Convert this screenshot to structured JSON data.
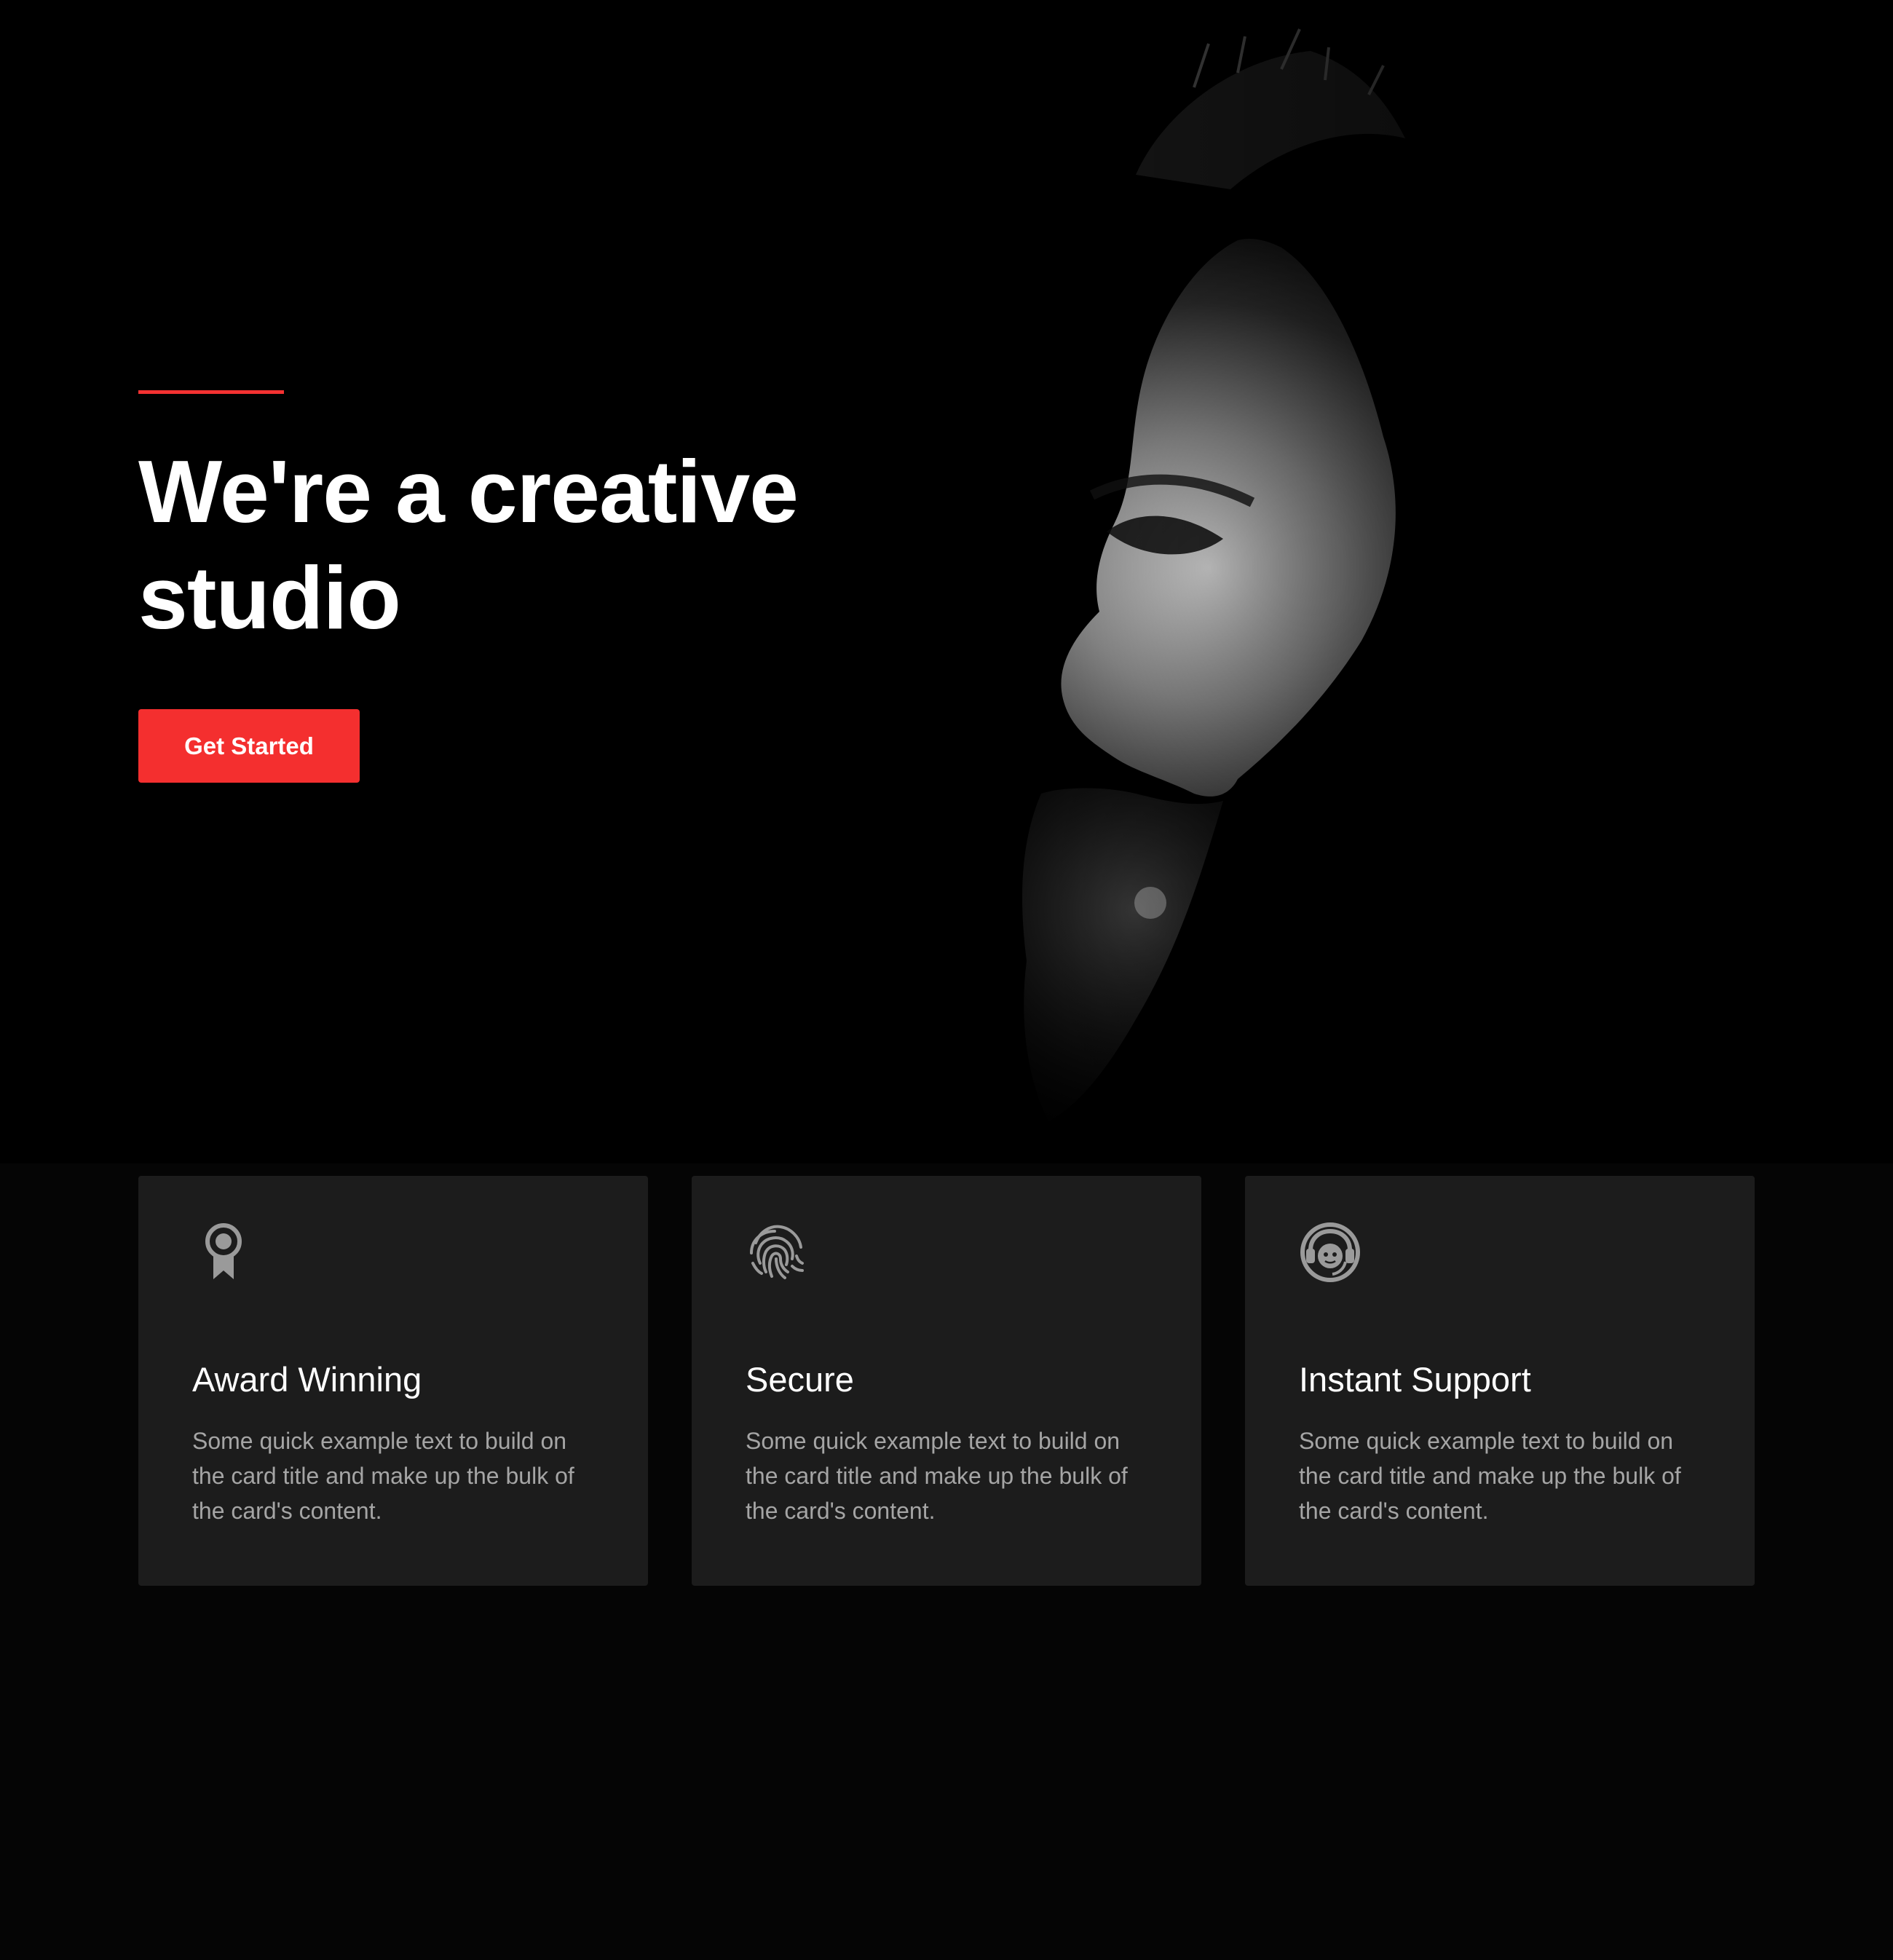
{
  "hero": {
    "title": "We're a creative studio",
    "cta_label": "Get Started",
    "accent_color": "#f43131",
    "image": "bearded-man-profile-portrait"
  },
  "features": [
    {
      "icon": "award-ribbon-icon",
      "title": "Award Winning",
      "text": "Some quick example text to build on the card title and make up the bulk of the card's content."
    },
    {
      "icon": "fingerprint-icon",
      "title": "Secure",
      "text": "Some quick example text to build on the card title and make up the bulk of the card's content."
    },
    {
      "icon": "support-headset-icon",
      "title": "Instant Support",
      "text": "Some quick example text to build on the card title and make up the bulk of the card's content."
    }
  ],
  "colors": {
    "background": "#050505",
    "card_background": "#1c1c1c",
    "button": "#f42f2f",
    "body_text": "#a5a5a5",
    "icon": "#9a9a9a"
  }
}
